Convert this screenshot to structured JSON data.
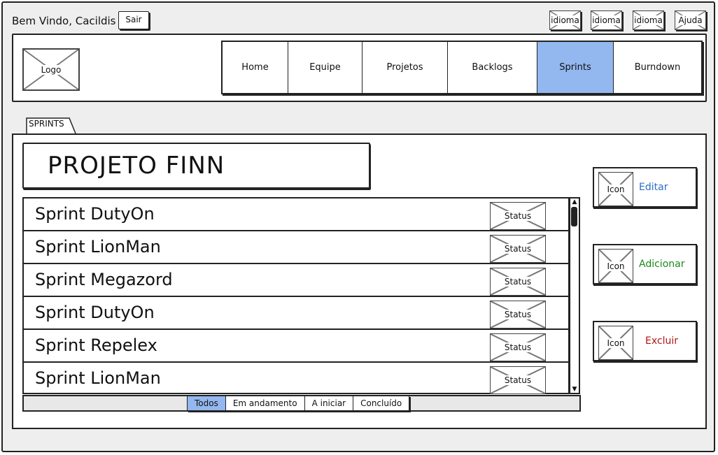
{
  "topbar": {
    "welcome": "Bem Vindo, Cacildis",
    "logout_label": "Sair",
    "language_buttons": [
      "idioma",
      "idioma",
      "idioma"
    ],
    "help_label": "Ajuda"
  },
  "header": {
    "logo_label": "Logo",
    "nav": [
      {
        "label": "Home",
        "active": false
      },
      {
        "label": "Equipe",
        "active": false
      },
      {
        "label": "Projetos",
        "active": false
      },
      {
        "label": "Backlogs",
        "active": false
      },
      {
        "label": "Sprints",
        "active": true
      },
      {
        "label": "Burndown",
        "active": false
      }
    ]
  },
  "section_tab": "SPRINTS",
  "project_title": "PROJETO FINN",
  "sprints": [
    {
      "name": "Sprint DutyOn",
      "status_label": "Status"
    },
    {
      "name": "Sprint LionMan",
      "status_label": "Status"
    },
    {
      "name": "Sprint Megazord",
      "status_label": "Status"
    },
    {
      "name": "Sprint DutyOn",
      "status_label": "Status"
    },
    {
      "name": "Sprint Repelex",
      "status_label": "Status"
    },
    {
      "name": "Sprint LionMan",
      "status_label": "Status"
    }
  ],
  "filters": [
    {
      "label": "Todos",
      "active": true
    },
    {
      "label": "Em andamento",
      "active": false
    },
    {
      "label": "A iniciar",
      "active": false
    },
    {
      "label": "Concluído",
      "active": false
    }
  ],
  "actions": [
    {
      "label": "Editar",
      "icon_label": "Icon",
      "color": "#2a6fc9"
    },
    {
      "label": "Adicionar",
      "icon_label": "Icon",
      "color": "#1a8c1a"
    },
    {
      "label": "Excluir",
      "icon_label": "Icon",
      "color": "#b01515"
    }
  ],
  "colors": {
    "active_bg": "#93b7ef",
    "frame_bg": "#eeeeee"
  }
}
